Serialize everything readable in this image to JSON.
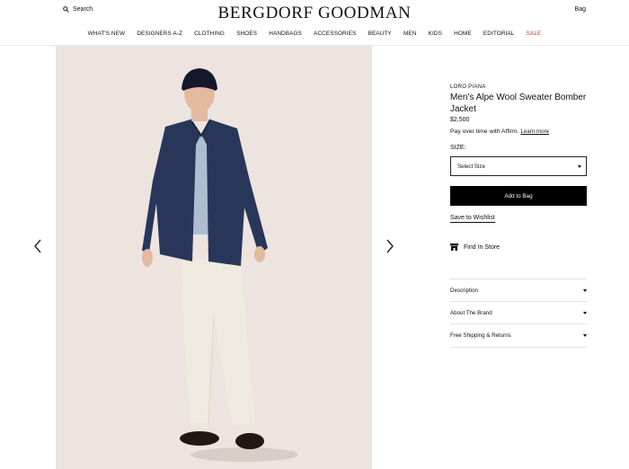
{
  "header": {
    "search_label": "Search",
    "logo": "BERGDORF GOODMAN",
    "bag_label": "Bag"
  },
  "nav": {
    "items": [
      "WHAT'S NEW",
      "DESIGNERS A-Z",
      "CLOTHING",
      "SHOES",
      "HANDBAGS",
      "ACCESSORIES",
      "BEAUTY",
      "MEN",
      "KIDS",
      "HOME",
      "EDITORIAL",
      "SALE"
    ],
    "sale_color": "#c0392b"
  },
  "product": {
    "brand": "LORO PIANA",
    "title": "Men's Alpe Wool Sweater Bomber Jacket",
    "price": "$2,500",
    "affirm_text": "Pay over time with Affirm.",
    "affirm_link": "Learn more",
    "size_label": "SIZE:",
    "size_select": "Select Size",
    "add_to_bag": "Add to Bag",
    "wishlist": "Save to Wishlist",
    "find_in_store": "Find In Store"
  },
  "accordions": [
    "Description",
    "About The Brand",
    "Free Shipping & Returns"
  ],
  "colors": {
    "hero_bg": "#ede4e0",
    "button_bg": "#000000"
  }
}
